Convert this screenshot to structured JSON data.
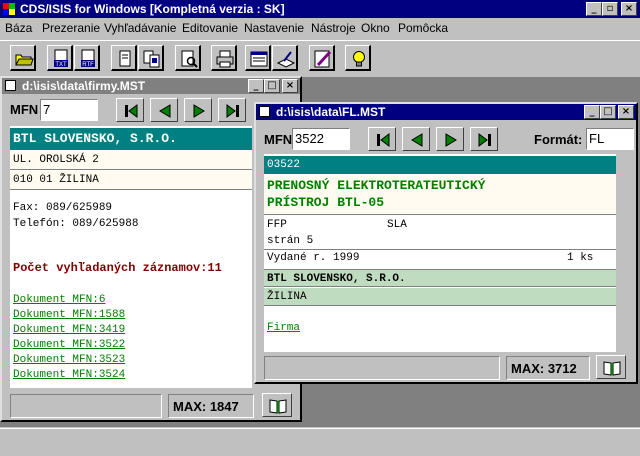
{
  "app": {
    "title": "CDS/ISIS for Windows [Kompletná verzia : SK]",
    "caption_buttons": [
      "_",
      "▫",
      "×"
    ]
  },
  "menu": [
    {
      "label": "Báza"
    },
    {
      "label": "Prezeranie"
    },
    {
      "label": "Vyhľadávanie"
    },
    {
      "label": "Editovanie"
    },
    {
      "label": "Nastavenie"
    },
    {
      "label": "Nástroje"
    },
    {
      "label": "Okno"
    },
    {
      "label": "Pomôcka"
    }
  ],
  "toolbar": {
    "icons": [
      "open-folder-icon",
      "txt-export-icon",
      "rtf-export-icon",
      "browse-record-icon",
      "copy-record-icon",
      "search-document-icon",
      "print-icon",
      "display-format-icon",
      "worksheet-icon",
      "edit-pencil-icon",
      "lightbulb-icon"
    ],
    "txt_label": "TXT",
    "rtf_label": "RTF"
  },
  "win1": {
    "title": "d:\\isis\\data\\firmy.MST",
    "mfn_label": "MFN",
    "mfn_value": "7",
    "company": "BTL SLOVENSKO, S.R.O.",
    "street": "UL. OROLSKÁ 2",
    "city": "010 01 ŽILINA",
    "fax": "Fax: 089/625989",
    "phone": "Telefón: 089/625988",
    "count_label": "Počet vyhľadaných záznamov:11",
    "links": [
      "Dokument MFN:6",
      "Dokument MFN:1588",
      "Dokument MFN:3419",
      "Dokument MFN:3522",
      "Dokument MFN:3523",
      "Dokument MFN:3524"
    ],
    "max_label": "MAX: 1847"
  },
  "win2": {
    "title": "d:\\isis\\data\\FL.MST",
    "mfn_label": "MFN",
    "mfn_value": "3522",
    "format_label": "Formát:",
    "format_value": "FL",
    "record_id": "03522",
    "title_line1": "PRENOSNÝ ELEKTROTERATEUTICKÝ",
    "title_line2": "PRÍSTROJ BTL-05",
    "ffp": "FFP",
    "sla": "SLA",
    "pages": "strán 5",
    "issued": "Vydané r. 1999",
    "qty": "1 ks",
    "company": "BTL SLOVENSKO, S.R.O.",
    "city": "ŽILINA",
    "link": "Firma",
    "max_label": "MAX: 3712"
  },
  "colors": {
    "titlebar": "#000080",
    "inactive_title": "#808080",
    "teal_header": "#008080",
    "cream": "#fffbf0",
    "mint": "#c0dcc0",
    "link_green": "#008000",
    "dark_red": "#800000"
  }
}
